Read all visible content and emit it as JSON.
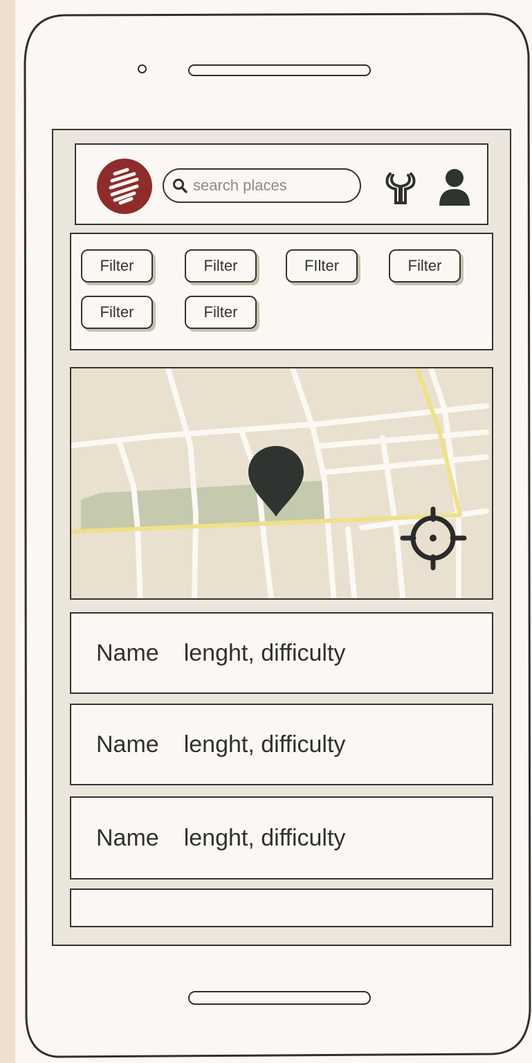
{
  "header": {
    "search": {
      "placeholder": "search places"
    }
  },
  "icons": {
    "logo": "scribble-logo-icon",
    "search": "magnifier-icon",
    "settings": "wrench-icon",
    "profile": "user-icon",
    "map_pin": "map-pin-icon",
    "locate": "crosshair-icon"
  },
  "filters": [
    {
      "label": "Filter"
    },
    {
      "label": "Filter"
    },
    {
      "label": "FIlter"
    },
    {
      "label": "Filter"
    },
    {
      "label": "Filter"
    },
    {
      "label": "Filter"
    }
  ],
  "list": [
    {
      "name": "Name",
      "meta": "lenght, difficulty"
    },
    {
      "name": "Name",
      "meta": "lenght, difficulty"
    },
    {
      "name": "Name",
      "meta": "lenght, difficulty"
    },
    {
      "name": "",
      "meta": ""
    }
  ],
  "colors": {
    "page_background": "#ecdfcd",
    "phone_surface": "#fbf8f4",
    "logo": "#8e2c2c",
    "ink": "#2f2f2f",
    "map_land": "#e9e0cf",
    "map_park": "#c5c9ad",
    "map_main_road": "#efe08a",
    "map_street": "#fbf8f4",
    "chip_shadow": "#cbbfae"
  }
}
